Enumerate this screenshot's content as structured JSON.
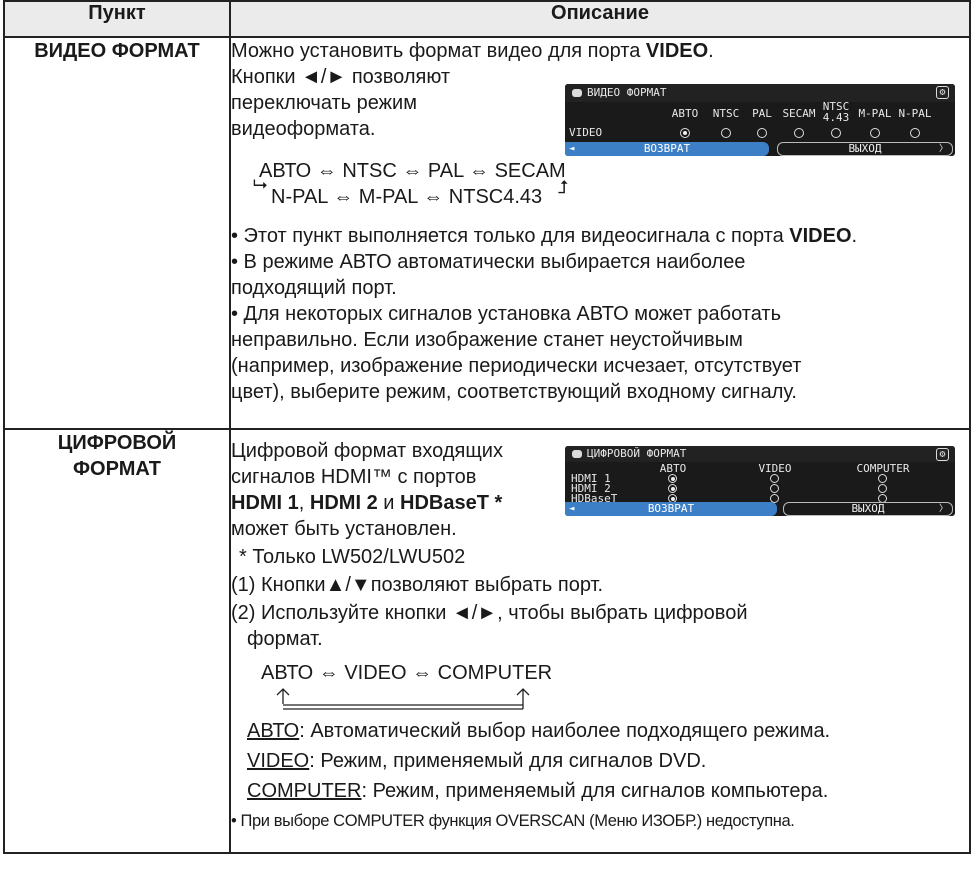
{
  "table": {
    "header_item": "Пункт",
    "header_desc": "Описание"
  },
  "video_format": {
    "label": "ВИДЕО ФОРМАТ",
    "intro_a": "Можно установить формат видео для порта ",
    "intro_b": "VIDEO",
    "intro_c": ".",
    "buttons_1": "Кнопки ◄/► позволяют",
    "buttons_2": "переключать режим",
    "buttons_3": "видеоформата.",
    "cycle_line1": "АВТО ⇔ NTSC ⇔ PAL ⇔ SECAM",
    "cycle_line2": "N-PAL ⇔ M-PAL ⇔ NTSC4.43",
    "note1_a": "• Этот пункт выполняется только для видеосигнала с порта ",
    "note1_b": "VIDEO",
    "note1_c": ".",
    "note2_1": "• В режиме АВТО автоматически выбирается наиболее",
    "note2_2": "подходящий порт.",
    "note3_1": "• Для некоторых сигналов установка АВТО может работать",
    "note3_2": "неправильно. Если изображение станет неустойчивым",
    "note3_3": "(например, изображение периодически исчезает, отсутствует",
    "note3_4": "цвет), выберите режим, соответствующий входному сигналу.",
    "osd": {
      "title": "ВИДЕО ФОРМАТ",
      "columns": [
        "АВТО",
        "NTSC",
        "PAL",
        "SECAM",
        "NTSC 4.43",
        "M-PAL",
        "N-PAL"
      ],
      "row_label": "VIDEO",
      "selected_index": 0,
      "back": "ВОЗВРАТ",
      "exit": "ВЫХОД"
    }
  },
  "digital_format": {
    "label_1": "ЦИФРОВОЙ",
    "label_2": "ФОРМАТ",
    "intro_1": "Цифровой формат входящих",
    "intro_2": "сигналов HDMI™ с портов",
    "intro_3a": "HDMI 1",
    "intro_3b": ", ",
    "intro_3c": "HDMI 2",
    "intro_3d": " и ",
    "intro_3e": "HDBaseT *",
    "intro_4": "может быть установлен.",
    "footnote": "* Только LW502/LWU502",
    "step1": "(1) Кнопки▲/▼позволяют выбрать порт.",
    "step2_1": "(2) Используйте кнопки ◄/►, чтобы выбрать цифровой",
    "step2_2": "формат.",
    "cycle": "АВТО ⇔ VIDEO ⇔ COMPUTER",
    "def_auto_term": "АВТО",
    "def_auto_text": ": Автоматический выбор наиболее подходящего режима.",
    "def_video_term": "VIDEO",
    "def_video_text": ": Режим, применяемый для сигналов DVD.",
    "def_comp_term": "COMPUTER",
    "def_comp_text": ": Режим, применяемый для сигналов компьютера.",
    "note": "• При выборе COMPUTER функция OVERSCAN (Меню ИЗОБР.) недоступна.",
    "osd": {
      "title": "ЦИФРОВОЙ ФОРМАТ",
      "columns": [
        "АВТО",
        "VIDEO",
        "COMPUTER"
      ],
      "rows": [
        "HDMI 1",
        "HDMI 2",
        "HDBaseT"
      ],
      "selected_index": 0,
      "back": "ВОЗВРАТ",
      "exit": "ВЫХОД"
    }
  }
}
